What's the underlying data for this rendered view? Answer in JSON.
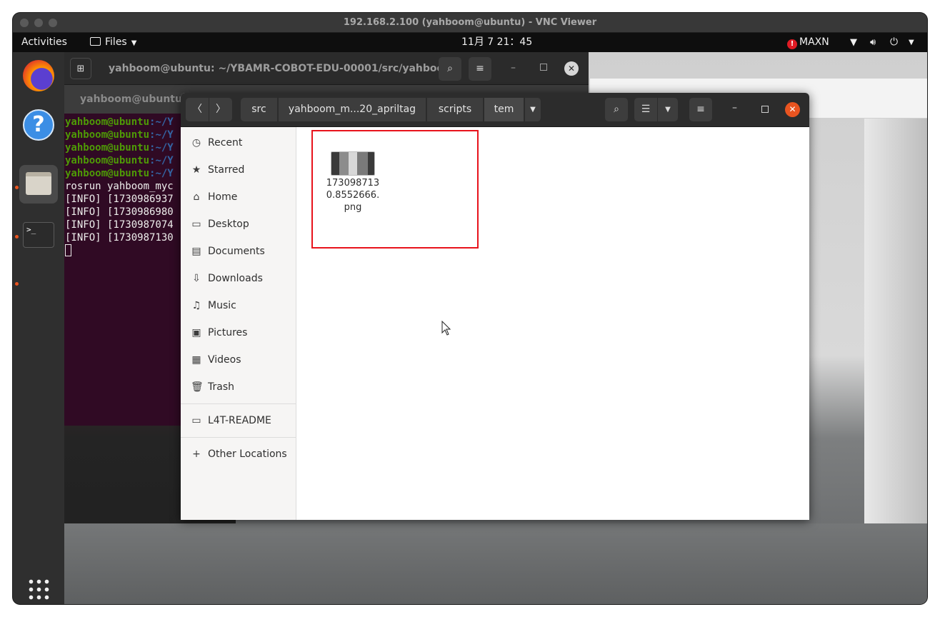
{
  "vnc": {
    "title": "192.168.2.100 (yahboom@ubuntu) - VNC Viewer"
  },
  "topbar": {
    "activities": "Activities",
    "app_menu": "Files",
    "clock": "11月 7  21：45",
    "power_mode": "MAXN"
  },
  "terminal": {
    "title": "yahboom@ubuntu: ~/YBAMR-COBOT-EDU-00001/src/yahboo...",
    "tab_title": "yahboom@ubuntu: ~",
    "prompt_user": "yahboom@ubuntu",
    "prompt_path": ":~/Y",
    "lines": [
      "rosrun yahboom_myc",
      "[INFO] [1730986937",
      "[INFO] [1730986980",
      "[INFO] [1730987074",
      "[INFO] [1730987130"
    ]
  },
  "files": {
    "breadcrumbs": [
      "src",
      "yahboom_m...20_apriltag",
      "scripts",
      "tem"
    ],
    "sidebar": [
      {
        "label": "Recent",
        "icon": "clock-icon"
      },
      {
        "label": "Starred",
        "icon": "star-icon"
      },
      {
        "label": "Home",
        "icon": "home-icon"
      },
      {
        "label": "Desktop",
        "icon": "desktop-icon"
      },
      {
        "label": "Documents",
        "icon": "document-icon"
      },
      {
        "label": "Downloads",
        "icon": "download-icon"
      },
      {
        "label": "Music",
        "icon": "music-icon"
      },
      {
        "label": "Pictures",
        "icon": "picture-icon"
      },
      {
        "label": "Videos",
        "icon": "video-icon"
      },
      {
        "label": "Trash",
        "icon": "trash-icon"
      }
    ],
    "devices": [
      {
        "label": "L4T-README",
        "icon": "drive-icon"
      }
    ],
    "other_locations": "Other Locations",
    "file": {
      "name_line1": "173098713",
      "name_line2": "0.8552666.",
      "name_line3": "png"
    }
  },
  "colors": {
    "ubuntu_orange": "#e95420",
    "highlight_red": "#e8131c",
    "terminal_bg": "#300a24"
  }
}
